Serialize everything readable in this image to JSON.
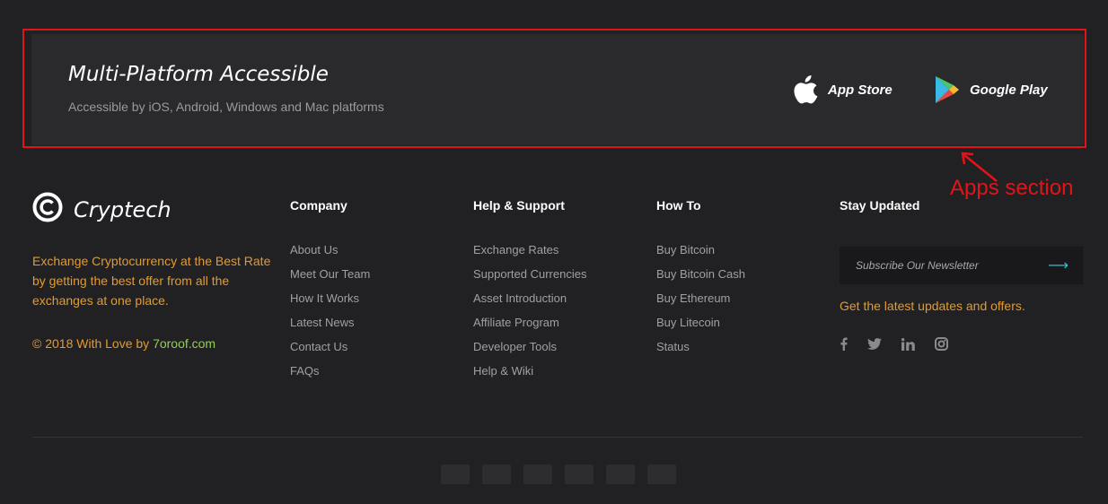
{
  "apps": {
    "title": "Multi-Platform Accessible",
    "subtitle": "Accessible by iOS, Android, Windows and Mac platforms",
    "app_store_label": "App Store",
    "google_play_label": "Google Play"
  },
  "annotation": {
    "label": "Apps section",
    "color": "#e2141a"
  },
  "brand": {
    "name": "Cryptech",
    "description": "Exchange Cryptocurrency at the Best Rate by getting the best offer from all the exchanges at one place.",
    "copyright_prefix": "© 2018 With Love by ",
    "copyright_site": "7oroof.com"
  },
  "columns": {
    "company": {
      "heading": "Company",
      "links": [
        "About Us",
        "Meet Our Team",
        "How It Works",
        "Latest News",
        "Contact Us",
        "FAQs"
      ]
    },
    "help": {
      "heading": "Help & Support",
      "links": [
        "Exchange Rates",
        "Supported Currencies",
        "Asset Introduction",
        "Affiliate Program",
        "Developer Tools",
        "Help & Wiki"
      ]
    },
    "howto": {
      "heading": "How To",
      "links": [
        "Buy Bitcoin",
        "Buy Bitcoin Cash",
        "Buy Ethereum",
        "Buy Litecoin",
        "Status"
      ]
    },
    "stay": {
      "heading": "Stay Updated",
      "newsletter_placeholder": "Subscribe Our Newsletter",
      "note": "Get the latest updates and offers."
    }
  },
  "socials": [
    "facebook-icon",
    "twitter-icon",
    "linkedin-icon",
    "instagram-icon"
  ],
  "payments": [
    "visa-icon",
    "mastercard-icon",
    "payment-icon-3",
    "payment-icon-4",
    "payment-icon-5",
    "payment-icon-6"
  ],
  "colors": {
    "background": "#212123",
    "banner": "#2a2a2c",
    "accent_orange": "#e59a2c",
    "accent_green": "#8fd14f",
    "accent_cyan": "#27c2d1"
  }
}
